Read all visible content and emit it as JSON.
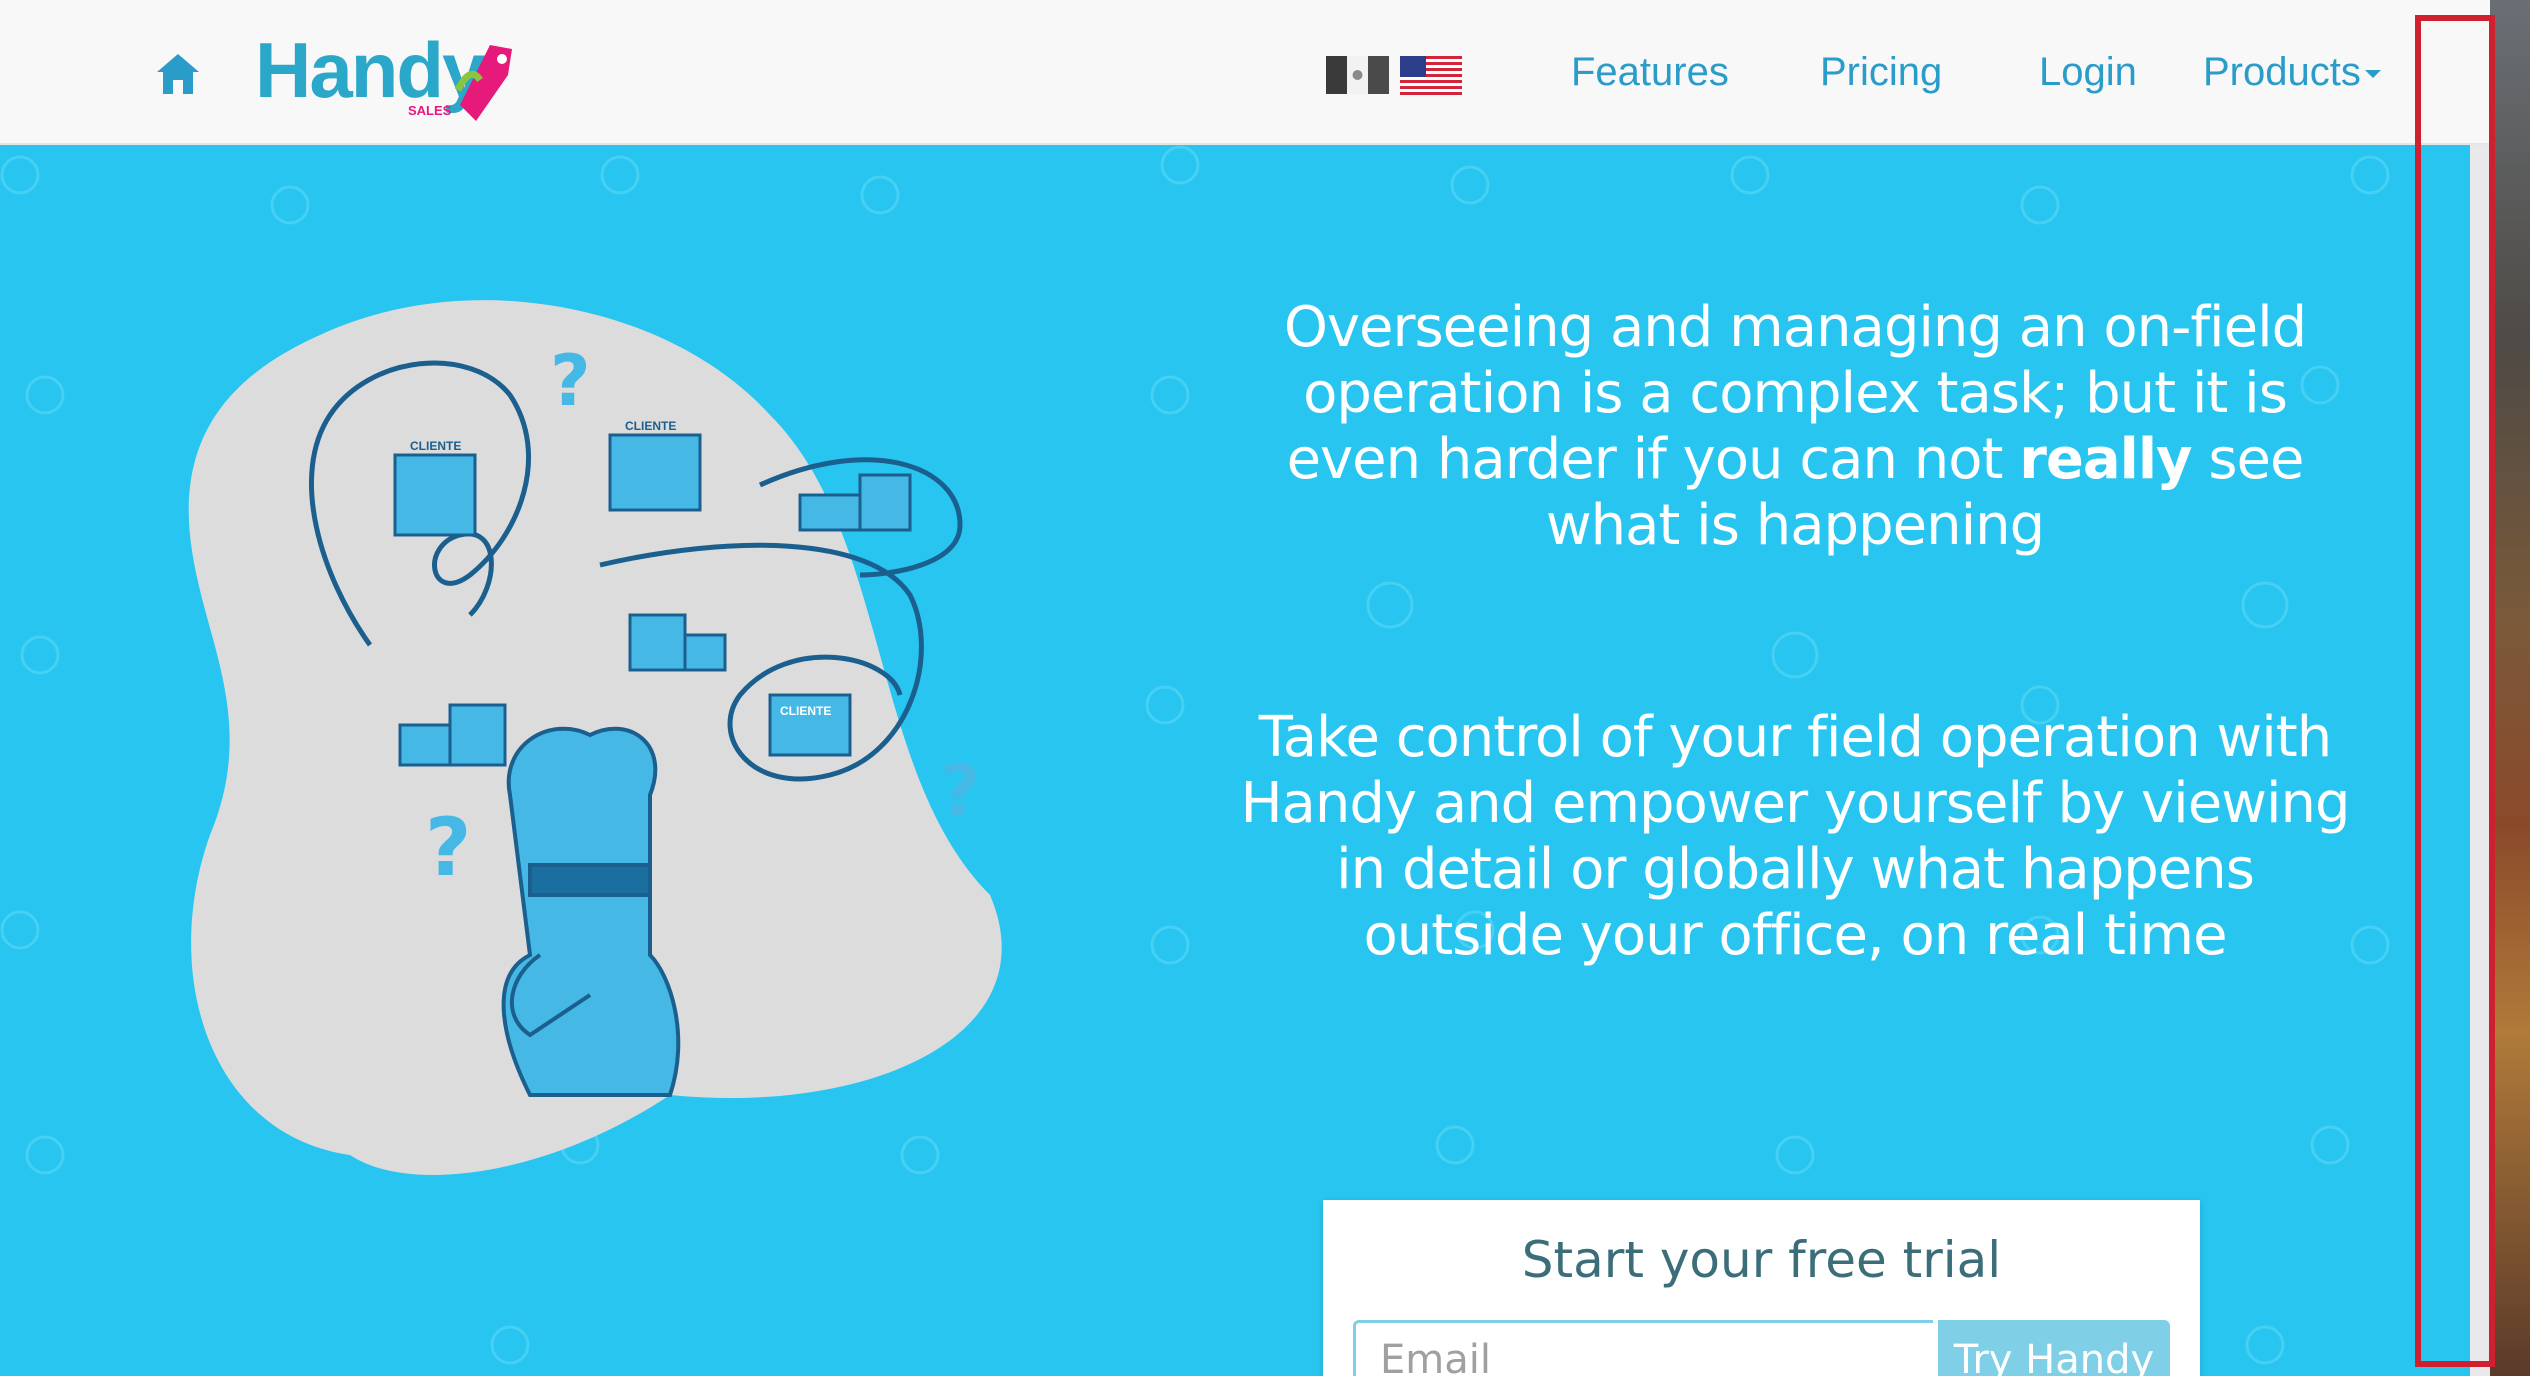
{
  "navbar": {
    "logo_text": "Handy",
    "logo_sub": "SALES",
    "links": {
      "features": "Features",
      "pricing": "Pricing",
      "login": "Login",
      "products": "Products"
    }
  },
  "hero": {
    "para1_before": "Overseeing and managing an on-field operation is a complex task; but it is even harder if you can not ",
    "para1_bold": "really",
    "para1_after": " see what is happening",
    "para2": "Take control of your field operation with Handy and empower yourself by viewing in detail or globally what happens outside your office, on real time"
  },
  "illustration": {
    "store_labels": [
      "CLIENTE",
      "CLIENTE",
      "CLIENTE"
    ],
    "question_mark": "?"
  },
  "trial": {
    "title": "Start your free trial",
    "email_placeholder": "Email",
    "button_label": "Try Handy"
  },
  "colors": {
    "hero_bg": "#27c5ef",
    "nav_link": "#2a9cc9",
    "logo": "#2aa7c9",
    "logo_accent": "#e51a7a",
    "highlight_frame": "#d01f2e"
  }
}
